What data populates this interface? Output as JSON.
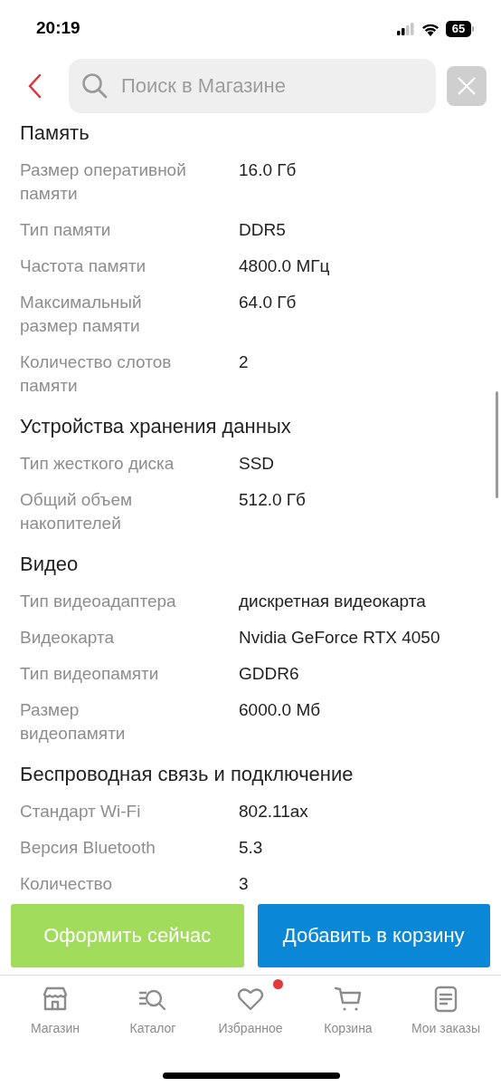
{
  "status_bar": {
    "time": "20:19",
    "battery": "65"
  },
  "search": {
    "placeholder": "Поиск в Магазине"
  },
  "sections": [
    {
      "title": "Память",
      "rows": [
        {
          "label": "Размер оперативной памяти",
          "value": "16.0 Гб"
        },
        {
          "label": "Тип памяти",
          "value": "DDR5"
        },
        {
          "label": "Частота памяти",
          "value": "4800.0 МГц"
        },
        {
          "label": "Максимальный размер памяти",
          "value": "64.0 Гб"
        },
        {
          "label": "Количество слотов памяти",
          "value": "2"
        }
      ]
    },
    {
      "title": "Устройства хранения данных",
      "rows": [
        {
          "label": "Тип жесткого диска",
          "value": "SSD"
        },
        {
          "label": "Общий объем накопителей",
          "value": "512.0 Гб"
        }
      ]
    },
    {
      "title": "Видео",
      "rows": [
        {
          "label": "Тип видеоадаптера",
          "value": "дискретная видеокарта"
        },
        {
          "label": "Видеокарта",
          "value": "Nvidia GeForce RTX 4050"
        },
        {
          "label": "Тип видеопамяти",
          "value": "GDDR6"
        },
        {
          "label": "Размер видеопамяти",
          "value": "6000.0 Мб"
        }
      ]
    },
    {
      "title": "Беспроводная связь и подключение",
      "rows": [
        {
          "label": "Стандарт Wi-Fi",
          "value": "802.11ax"
        },
        {
          "label": "Версия Bluetooth",
          "value": "5.3"
        },
        {
          "label": "Количество",
          "value": "3"
        }
      ]
    }
  ],
  "actions": [
    {
      "label": "Оформить сейчас",
      "kind": "checkout"
    },
    {
      "label": "Добавить в корзину",
      "kind": "cart"
    }
  ],
  "nav": [
    {
      "label": "Магазин",
      "badge": false
    },
    {
      "label": "Каталог",
      "badge": false
    },
    {
      "label": "Избранное",
      "badge": true
    },
    {
      "label": "Корзина",
      "badge": false
    },
    {
      "label": "Мои заказы",
      "badge": false
    }
  ]
}
